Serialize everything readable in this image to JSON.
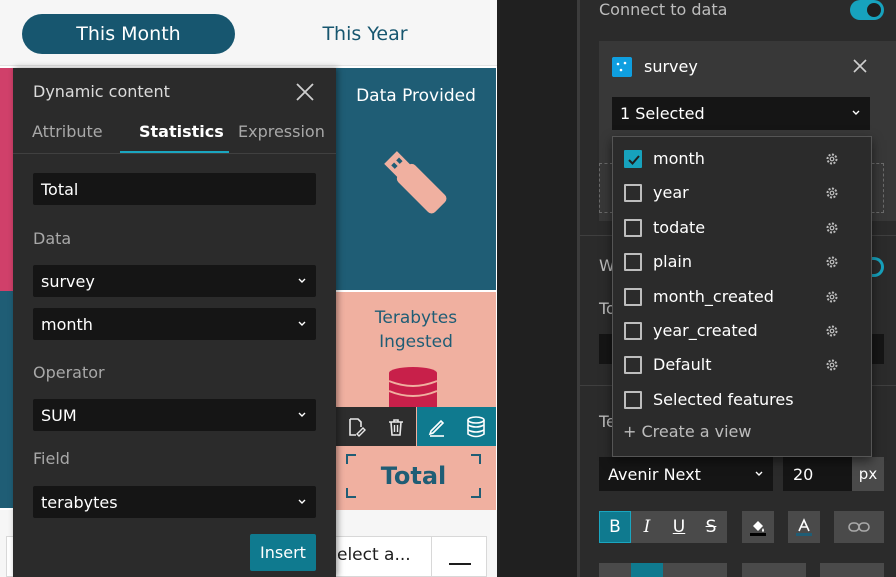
{
  "period_tabs": {
    "month": "This Month",
    "year": "This Year"
  },
  "cards": {
    "data_provided": {
      "title": "Data Provided",
      "icon": "usb-drive-icon"
    },
    "terabytes": {
      "title_line1": "Terabytes",
      "title_line2": "Ingested",
      "icon": "database-icon",
      "value_text": "Total"
    }
  },
  "select_bar": {
    "text": "elect a..."
  },
  "dynamic_content": {
    "title": "Dynamic content",
    "tabs": [
      "Attribute",
      "Statistics",
      "Expression"
    ],
    "active_tab": "Statistics",
    "text_value": "Total",
    "data_label": "Data",
    "data_source": "survey",
    "data_view": "month",
    "operator_label": "Operator",
    "operator": "SUM",
    "field_label": "Field",
    "field": "terabytes",
    "insert_label": "Insert"
  },
  "settings": {
    "connect_label": "Connect to data",
    "connect_enabled": true,
    "data_source_name": "survey",
    "selected_label": "1 Selected",
    "stubs": {
      "w": "W",
      "to": "To",
      "te": "Te"
    },
    "font_family": "Avenir Next",
    "font_size": "20",
    "font_unit": "px"
  },
  "field_list": {
    "items": [
      {
        "label": "month",
        "checked": true,
        "gear": true
      },
      {
        "label": "year",
        "checked": false,
        "gear": true
      },
      {
        "label": "todate",
        "checked": false,
        "gear": true
      },
      {
        "label": "plain",
        "checked": false,
        "gear": true
      },
      {
        "label": "month_created",
        "checked": false,
        "gear": true
      },
      {
        "label": "year_created",
        "checked": false,
        "gear": true
      },
      {
        "label": "Default",
        "checked": false,
        "gear": true
      },
      {
        "label": "Selected features",
        "checked": false,
        "gear": false
      }
    ],
    "create_view_label": "+ Create a view"
  },
  "colors": {
    "teal_dark": "#1f5d75",
    "salmon": "#f0b0a0",
    "accent": "#17a2bd",
    "pink": "#d0406a"
  }
}
